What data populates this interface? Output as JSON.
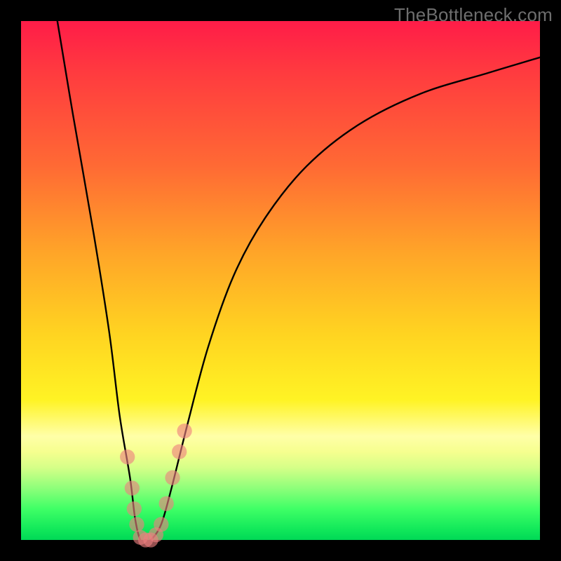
{
  "watermark": "TheBottleneck.com",
  "chart_data": {
    "type": "line",
    "title": "",
    "xlabel": "",
    "ylabel": "",
    "xlim": [
      0,
      100
    ],
    "ylim": [
      0,
      100
    ],
    "grid": false,
    "legend": false,
    "series": [
      {
        "name": "bottleneck-curve",
        "x": [
          7,
          10,
          14,
          17,
          19,
          21,
          22,
          23,
          24,
          25,
          27,
          29,
          32,
          36,
          41,
          47,
          55,
          65,
          77,
          90,
          100
        ],
        "y": [
          100,
          82,
          59,
          40,
          24,
          12,
          4,
          0,
          0,
          0,
          3,
          10,
          22,
          37,
          51,
          62,
          72,
          80,
          86,
          90,
          93
        ]
      }
    ],
    "markers": {
      "name": "highlight-dots",
      "color": "#ed7f80",
      "points": [
        {
          "x": 20.5,
          "y": 16,
          "r": 1.6
        },
        {
          "x": 21.4,
          "y": 10,
          "r": 1.6
        },
        {
          "x": 21.8,
          "y": 6,
          "r": 1.6
        },
        {
          "x": 22.3,
          "y": 3,
          "r": 1.6
        },
        {
          "x": 23.0,
          "y": 0.5,
          "r": 1.6
        },
        {
          "x": 24.0,
          "y": 0,
          "r": 1.6
        },
        {
          "x": 25.0,
          "y": 0,
          "r": 1.6
        },
        {
          "x": 26.0,
          "y": 1,
          "r": 1.6
        },
        {
          "x": 27.0,
          "y": 3,
          "r": 1.6
        },
        {
          "x": 28.0,
          "y": 7,
          "r": 1.6
        },
        {
          "x": 29.2,
          "y": 12,
          "r": 1.6
        },
        {
          "x": 30.5,
          "y": 17,
          "r": 1.6
        },
        {
          "x": 31.5,
          "y": 21,
          "r": 1.6
        }
      ]
    },
    "background_gradient": {
      "top": "#ff1c48",
      "mid1": "#ffa628",
      "mid2": "#fff324",
      "pale_band": "#ffffa8",
      "bottom": "#00d856"
    }
  }
}
